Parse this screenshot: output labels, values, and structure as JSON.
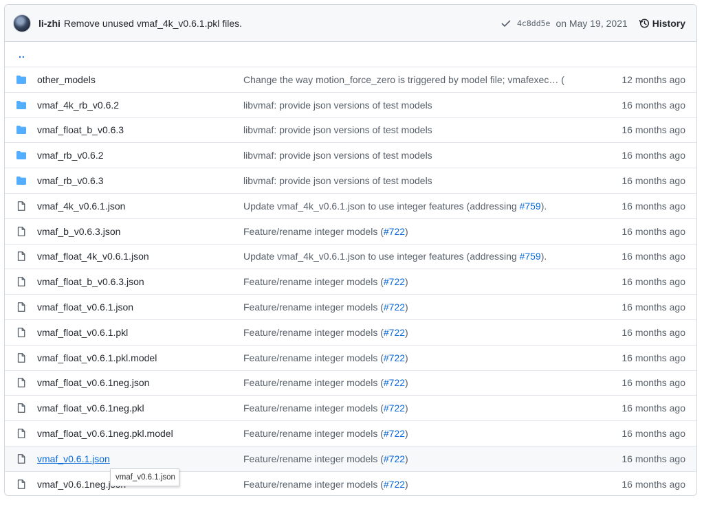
{
  "commit": {
    "author": "li-zhi",
    "message": "Remove unused vmaf_4k_v0.6.1.pkl files.",
    "sha": "4c8dd5e",
    "date": "on May 19, 2021",
    "history_label": "History"
  },
  "parent_dir": "..",
  "rows": [
    {
      "type": "dir",
      "name": "other_models",
      "msg": "Change the way motion_force_zero is triggered by model file; vmafexec… (",
      "pr": "",
      "msg_end": "",
      "age": "12 months ago"
    },
    {
      "type": "dir",
      "name": "vmaf_4k_rb_v0.6.2",
      "msg": "libvmaf: provide json versions of test models",
      "pr": "",
      "msg_end": "",
      "age": "16 months ago"
    },
    {
      "type": "dir",
      "name": "vmaf_float_b_v0.6.3",
      "msg": "libvmaf: provide json versions of test models",
      "pr": "",
      "msg_end": "",
      "age": "16 months ago"
    },
    {
      "type": "dir",
      "name": "vmaf_rb_v0.6.2",
      "msg": "libvmaf: provide json versions of test models",
      "pr": "",
      "msg_end": "",
      "age": "16 months ago"
    },
    {
      "type": "dir",
      "name": "vmaf_rb_v0.6.3",
      "msg": "libvmaf: provide json versions of test models",
      "pr": "",
      "msg_end": "",
      "age": "16 months ago"
    },
    {
      "type": "file",
      "name": "vmaf_4k_v0.6.1.json",
      "msg": "Update vmaf_4k_v0.6.1.json to use integer features (addressing ",
      "pr": "#759",
      "msg_end": ").",
      "age": "16 months ago"
    },
    {
      "type": "file",
      "name": "vmaf_b_v0.6.3.json",
      "msg": "Feature/rename integer models (",
      "pr": "#722",
      "msg_end": ")",
      "age": "16 months ago"
    },
    {
      "type": "file",
      "name": "vmaf_float_4k_v0.6.1.json",
      "msg": "Update vmaf_4k_v0.6.1.json to use integer features (addressing ",
      "pr": "#759",
      "msg_end": ").",
      "age": "16 months ago"
    },
    {
      "type": "file",
      "name": "vmaf_float_b_v0.6.3.json",
      "msg": "Feature/rename integer models (",
      "pr": "#722",
      "msg_end": ")",
      "age": "16 months ago"
    },
    {
      "type": "file",
      "name": "vmaf_float_v0.6.1.json",
      "msg": "Feature/rename integer models (",
      "pr": "#722",
      "msg_end": ")",
      "age": "16 months ago"
    },
    {
      "type": "file",
      "name": "vmaf_float_v0.6.1.pkl",
      "msg": "Feature/rename integer models (",
      "pr": "#722",
      "msg_end": ")",
      "age": "16 months ago"
    },
    {
      "type": "file",
      "name": "vmaf_float_v0.6.1.pkl.model",
      "msg": "Feature/rename integer models (",
      "pr": "#722",
      "msg_end": ")",
      "age": "16 months ago"
    },
    {
      "type": "file",
      "name": "vmaf_float_v0.6.1neg.json",
      "msg": "Feature/rename integer models (",
      "pr": "#722",
      "msg_end": ")",
      "age": "16 months ago"
    },
    {
      "type": "file",
      "name": "vmaf_float_v0.6.1neg.pkl",
      "msg": "Feature/rename integer models (",
      "pr": "#722",
      "msg_end": ")",
      "age": "16 months ago"
    },
    {
      "type": "file",
      "name": "vmaf_float_v0.6.1neg.pkl.model",
      "msg": "Feature/rename integer models (",
      "pr": "#722",
      "msg_end": ")",
      "age": "16 months ago"
    },
    {
      "type": "file",
      "name": "vmaf_v0.6.1.json",
      "msg": "Feature/rename integer models (",
      "pr": "#722",
      "msg_end": ")",
      "age": "16 months ago",
      "hovered": true
    },
    {
      "type": "file",
      "name": "vmaf_v0.6.1neg.json",
      "msg": "Feature/rename integer models (",
      "pr": "#722",
      "msg_end": ")",
      "age": "16 months ago"
    }
  ],
  "tooltip": "vmaf_v0.6.1.json",
  "colors": {
    "folder": "#54aeff",
    "link": "#0969da",
    "muted": "#57606a"
  }
}
